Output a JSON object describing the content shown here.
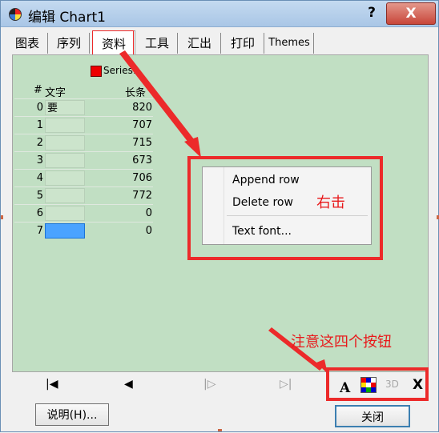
{
  "window": {
    "title": "编辑 Chart1",
    "help_glyph": "?",
    "close_glyph": "X"
  },
  "tabs": [
    {
      "label": "图表"
    },
    {
      "label": "序列"
    },
    {
      "label": "资料"
    },
    {
      "label": "工具"
    },
    {
      "label": "汇出"
    },
    {
      "label": "打印"
    },
    {
      "label": "Themes"
    }
  ],
  "grid": {
    "series_name": "Series1",
    "series_color": "#ee0000",
    "headers": {
      "index": "#",
      "text": "文字",
      "value": "长条"
    },
    "rows": [
      {
        "index": "0",
        "text": "要",
        "value": "820"
      },
      {
        "index": "1",
        "text": "",
        "value": "707"
      },
      {
        "index": "2",
        "text": "",
        "value": "715"
      },
      {
        "index": "3",
        "text": "",
        "value": "673"
      },
      {
        "index": "4",
        "text": "",
        "value": "706"
      },
      {
        "index": "5",
        "text": "",
        "value": "772"
      },
      {
        "index": "6",
        "text": "",
        "value": "0"
      },
      {
        "index": "7",
        "text": "",
        "value": "0"
      }
    ]
  },
  "context_menu": {
    "items": [
      {
        "label": "Append row"
      },
      {
        "label": "Delete row"
      },
      {
        "label": "Text font..."
      }
    ]
  },
  "annotations": {
    "right_click": "右击",
    "note_buttons": "注意这四个按钮",
    "color": "#ec2a2a"
  },
  "navigator": {
    "first": "|◀",
    "prev": "◀",
    "next": "|▷",
    "last": "▷|"
  },
  "toolbar": {
    "font_button": "A",
    "color_button_icon": "color-palette-icon",
    "three_d": "3D",
    "delete_button": "X"
  },
  "buttons": {
    "help": "说明(H)...",
    "close": "关闭"
  },
  "colors": {
    "panel_bg": "#c1dfc3",
    "selected_cell": "#4aa3ff",
    "titlebar": "#b5cfea"
  }
}
